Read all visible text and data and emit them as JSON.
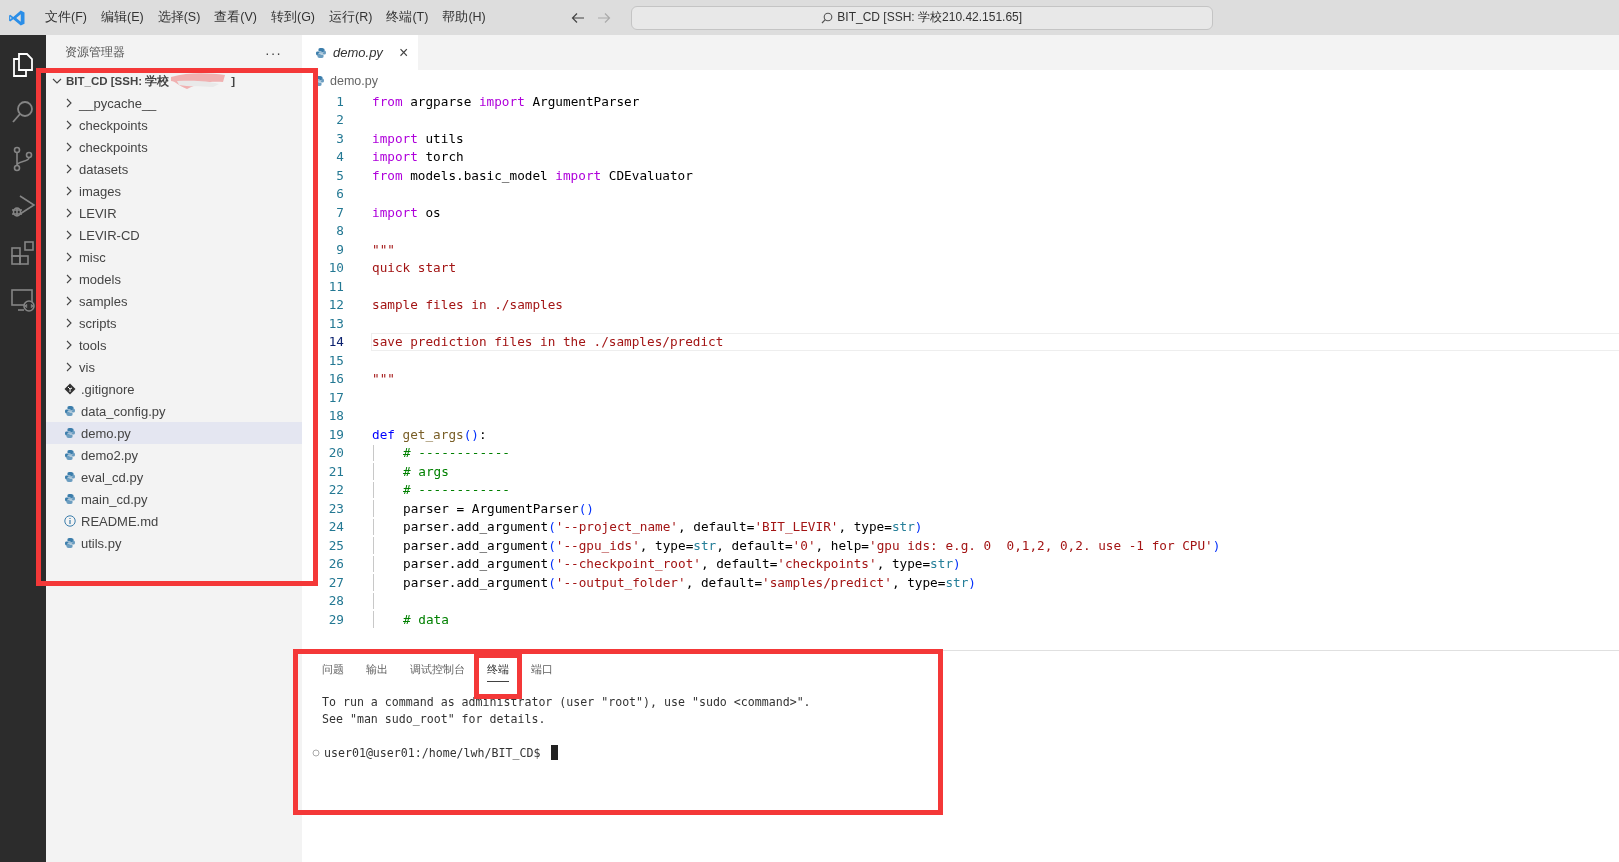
{
  "title_bar": {
    "menu": [
      "文件(F)",
      "编辑(E)",
      "选择(S)",
      "查看(V)",
      "转到(G)",
      "运行(R)",
      "终端(T)",
      "帮助(H)"
    ],
    "search": "BIT_CD [SSH: 学校210.42.151.65]"
  },
  "activity_bar": [
    {
      "kind": "explorer",
      "selected": true
    },
    {
      "kind": "search",
      "selected": false
    },
    {
      "kind": "source_control",
      "selected": false
    },
    {
      "kind": "run_debug",
      "selected": false
    },
    {
      "kind": "extensions",
      "selected": false
    },
    {
      "kind": "remote",
      "selected": false
    }
  ],
  "explorer": {
    "title": "资源管理器",
    "more": "···",
    "highlighted": true,
    "root": {
      "label": "BIT_CD [SSH: 学校",
      "label_end": "]",
      "redacted": true,
      "expanded": true,
      "children": [
        {
          "name": "__pycache__",
          "kind": "folder",
          "selected": false
        },
        {
          "name": "checkpoints",
          "kind": "folder",
          "selected": false
        },
        {
          "name": "checkpoints",
          "kind": "folder",
          "selected": false
        },
        {
          "name": "datasets",
          "kind": "folder",
          "selected": false
        },
        {
          "name": "images",
          "kind": "folder",
          "selected": false
        },
        {
          "name": "LEVIR",
          "kind": "folder",
          "selected": false
        },
        {
          "name": "LEVIR-CD",
          "kind": "folder",
          "selected": false
        },
        {
          "name": "misc",
          "kind": "folder",
          "selected": false
        },
        {
          "name": "models",
          "kind": "folder",
          "selected": false
        },
        {
          "name": "samples",
          "kind": "folder",
          "selected": false
        },
        {
          "name": "scripts",
          "kind": "folder",
          "selected": false
        },
        {
          "name": "tools",
          "kind": "folder",
          "selected": false
        },
        {
          "name": "vis",
          "kind": "folder",
          "selected": false
        },
        {
          "name": ".gitignore",
          "kind": "git",
          "selected": false
        },
        {
          "name": "data_config.py",
          "kind": "python",
          "selected": false
        },
        {
          "name": "demo.py",
          "kind": "python",
          "selected": true
        },
        {
          "name": "demo2.py",
          "kind": "python",
          "selected": false
        },
        {
          "name": "eval_cd.py",
          "kind": "python",
          "selected": false
        },
        {
          "name": "main_cd.py",
          "kind": "python",
          "selected": false
        },
        {
          "name": "README.md",
          "kind": "info",
          "selected": false
        },
        {
          "name": "utils.py",
          "kind": "python",
          "selected": false
        }
      ]
    }
  },
  "editor": {
    "tabs": [
      {
        "label": "demo.py",
        "selected": true,
        "close": "×"
      }
    ],
    "breadcrumb": "demo.py",
    "lines": [
      {
        "n": "1",
        "current": false,
        "indent": false,
        "tokens": [
          {
            "keyword": "from"
          },
          {
            "plain": " argparse "
          },
          {
            "keyword": "import"
          },
          {
            "plain": " ArgumentParser"
          }
        ]
      },
      {
        "n": "2",
        "current": false,
        "indent": false
      },
      {
        "n": "3",
        "current": false,
        "indent": false,
        "tokens": [
          {
            "keyword": "import"
          },
          {
            "plain": " utils"
          }
        ]
      },
      {
        "n": "4",
        "current": false,
        "indent": false,
        "tokens": [
          {
            "keyword": "import"
          },
          {
            "plain": " torch"
          }
        ]
      },
      {
        "n": "5",
        "current": false,
        "indent": false,
        "tokens": [
          {
            "keyword": "from"
          },
          {
            "plain": " models.basic_model "
          },
          {
            "keyword": "import"
          },
          {
            "plain": " CDEvaluator"
          }
        ]
      },
      {
        "n": "6",
        "current": false,
        "indent": false
      },
      {
        "n": "7",
        "current": false,
        "indent": false,
        "tokens": [
          {
            "keyword": "import"
          },
          {
            "plain": " os"
          }
        ]
      },
      {
        "n": "8",
        "current": false,
        "indent": false
      },
      {
        "n": "9",
        "current": false,
        "indent": false,
        "tokens": [
          {
            "string": "\"\"\""
          }
        ]
      },
      {
        "n": "10",
        "current": false,
        "indent": false,
        "tokens": [
          {
            "string": "quick start"
          }
        ]
      },
      {
        "n": "11",
        "current": false,
        "indent": false
      },
      {
        "n": "12",
        "current": false,
        "indent": false,
        "tokens": [
          {
            "string": "sample files in ./samples"
          }
        ]
      },
      {
        "n": "13",
        "current": false,
        "indent": false
      },
      {
        "n": "14",
        "current": true,
        "indent": false,
        "tokens": [
          {
            "string": "save prediction files in the ./samples/predict"
          }
        ]
      },
      {
        "n": "15",
        "current": false,
        "indent": false
      },
      {
        "n": "16",
        "current": false,
        "indent": false,
        "tokens": [
          {
            "string": "\"\"\""
          }
        ]
      },
      {
        "n": "17",
        "current": false,
        "indent": false
      },
      {
        "n": "18",
        "current": false,
        "indent": false
      },
      {
        "n": "19",
        "current": false,
        "indent": false,
        "tokens": [
          {
            "def": "def "
          },
          {
            "function": "get_args"
          },
          {
            "paren": "()"
          },
          {
            "plain": ":"
          }
        ]
      },
      {
        "n": "20",
        "current": false,
        "indent": true,
        "tokens": [
          {
            "comment": "# ------------"
          }
        ]
      },
      {
        "n": "21",
        "current": false,
        "indent": true,
        "tokens": [
          {
            "comment": "# args"
          }
        ]
      },
      {
        "n": "22",
        "current": false,
        "indent": true,
        "tokens": [
          {
            "comment": "# ------------"
          }
        ]
      },
      {
        "n": "23",
        "current": false,
        "indent": true,
        "tokens": [
          {
            "plain": "parser = ArgumentParser"
          },
          {
            "paren": "()"
          }
        ]
      },
      {
        "n": "24",
        "current": false,
        "indent": true,
        "tokens": [
          {
            "plain": "parser.add_argument"
          },
          {
            "paren": "("
          },
          {
            "string": "'--project_name'"
          },
          {
            "plain": ", default="
          },
          {
            "string": "'BIT_LEVIR'"
          },
          {
            "plain": ", type="
          },
          {
            "type": "str"
          },
          {
            "paren": ")"
          }
        ]
      },
      {
        "n": "25",
        "current": false,
        "indent": true,
        "tokens": [
          {
            "plain": "parser.add_argument"
          },
          {
            "paren": "("
          },
          {
            "string": "'--gpu_ids'"
          },
          {
            "plain": ", type="
          },
          {
            "type": "str"
          },
          {
            "plain": ", default="
          },
          {
            "string": "'0'"
          },
          {
            "plain": ", help="
          },
          {
            "string": "'gpu ids: e.g. 0  0,1,2, 0,2. use -1 for CPU'"
          },
          {
            "paren": ")"
          }
        ]
      },
      {
        "n": "26",
        "current": false,
        "indent": true,
        "tokens": [
          {
            "plain": "parser.add_argument"
          },
          {
            "paren": "("
          },
          {
            "string": "'--checkpoint_root'"
          },
          {
            "plain": ", default="
          },
          {
            "string": "'checkpoints'"
          },
          {
            "plain": ", type="
          },
          {
            "type": "str"
          },
          {
            "paren": ")"
          }
        ]
      },
      {
        "n": "27",
        "current": false,
        "indent": true,
        "tokens": [
          {
            "plain": "parser.add_argument"
          },
          {
            "paren": "("
          },
          {
            "string": "'--output_folder'"
          },
          {
            "plain": ", default="
          },
          {
            "string": "'samples/predict'"
          },
          {
            "plain": ", type="
          },
          {
            "type": "str"
          },
          {
            "paren": ")"
          }
        ]
      },
      {
        "n": "28",
        "current": false,
        "indent": true
      },
      {
        "n": "29",
        "current": false,
        "indent": true,
        "tokens": [
          {
            "comment": "# data"
          }
        ]
      }
    ]
  },
  "panel": {
    "highlighted": true,
    "tabs": [
      {
        "label": "问题",
        "selected": false,
        "highlighted": false
      },
      {
        "label": "输出",
        "selected": false,
        "highlighted": false
      },
      {
        "label": "调试控制台",
        "selected": false,
        "highlighted": false
      },
      {
        "label": "终端",
        "selected": true,
        "highlighted": true
      },
      {
        "label": "端口",
        "selected": false,
        "highlighted": false
      }
    ],
    "terminal": {
      "lines": [
        "To run a command as administrator (user \"root\"), use \"sudo <command>\".",
        "See \"man sudo_root\" for details."
      ],
      "prompt": "user01@user01:/home/lwh/BIT_CD$"
    }
  }
}
